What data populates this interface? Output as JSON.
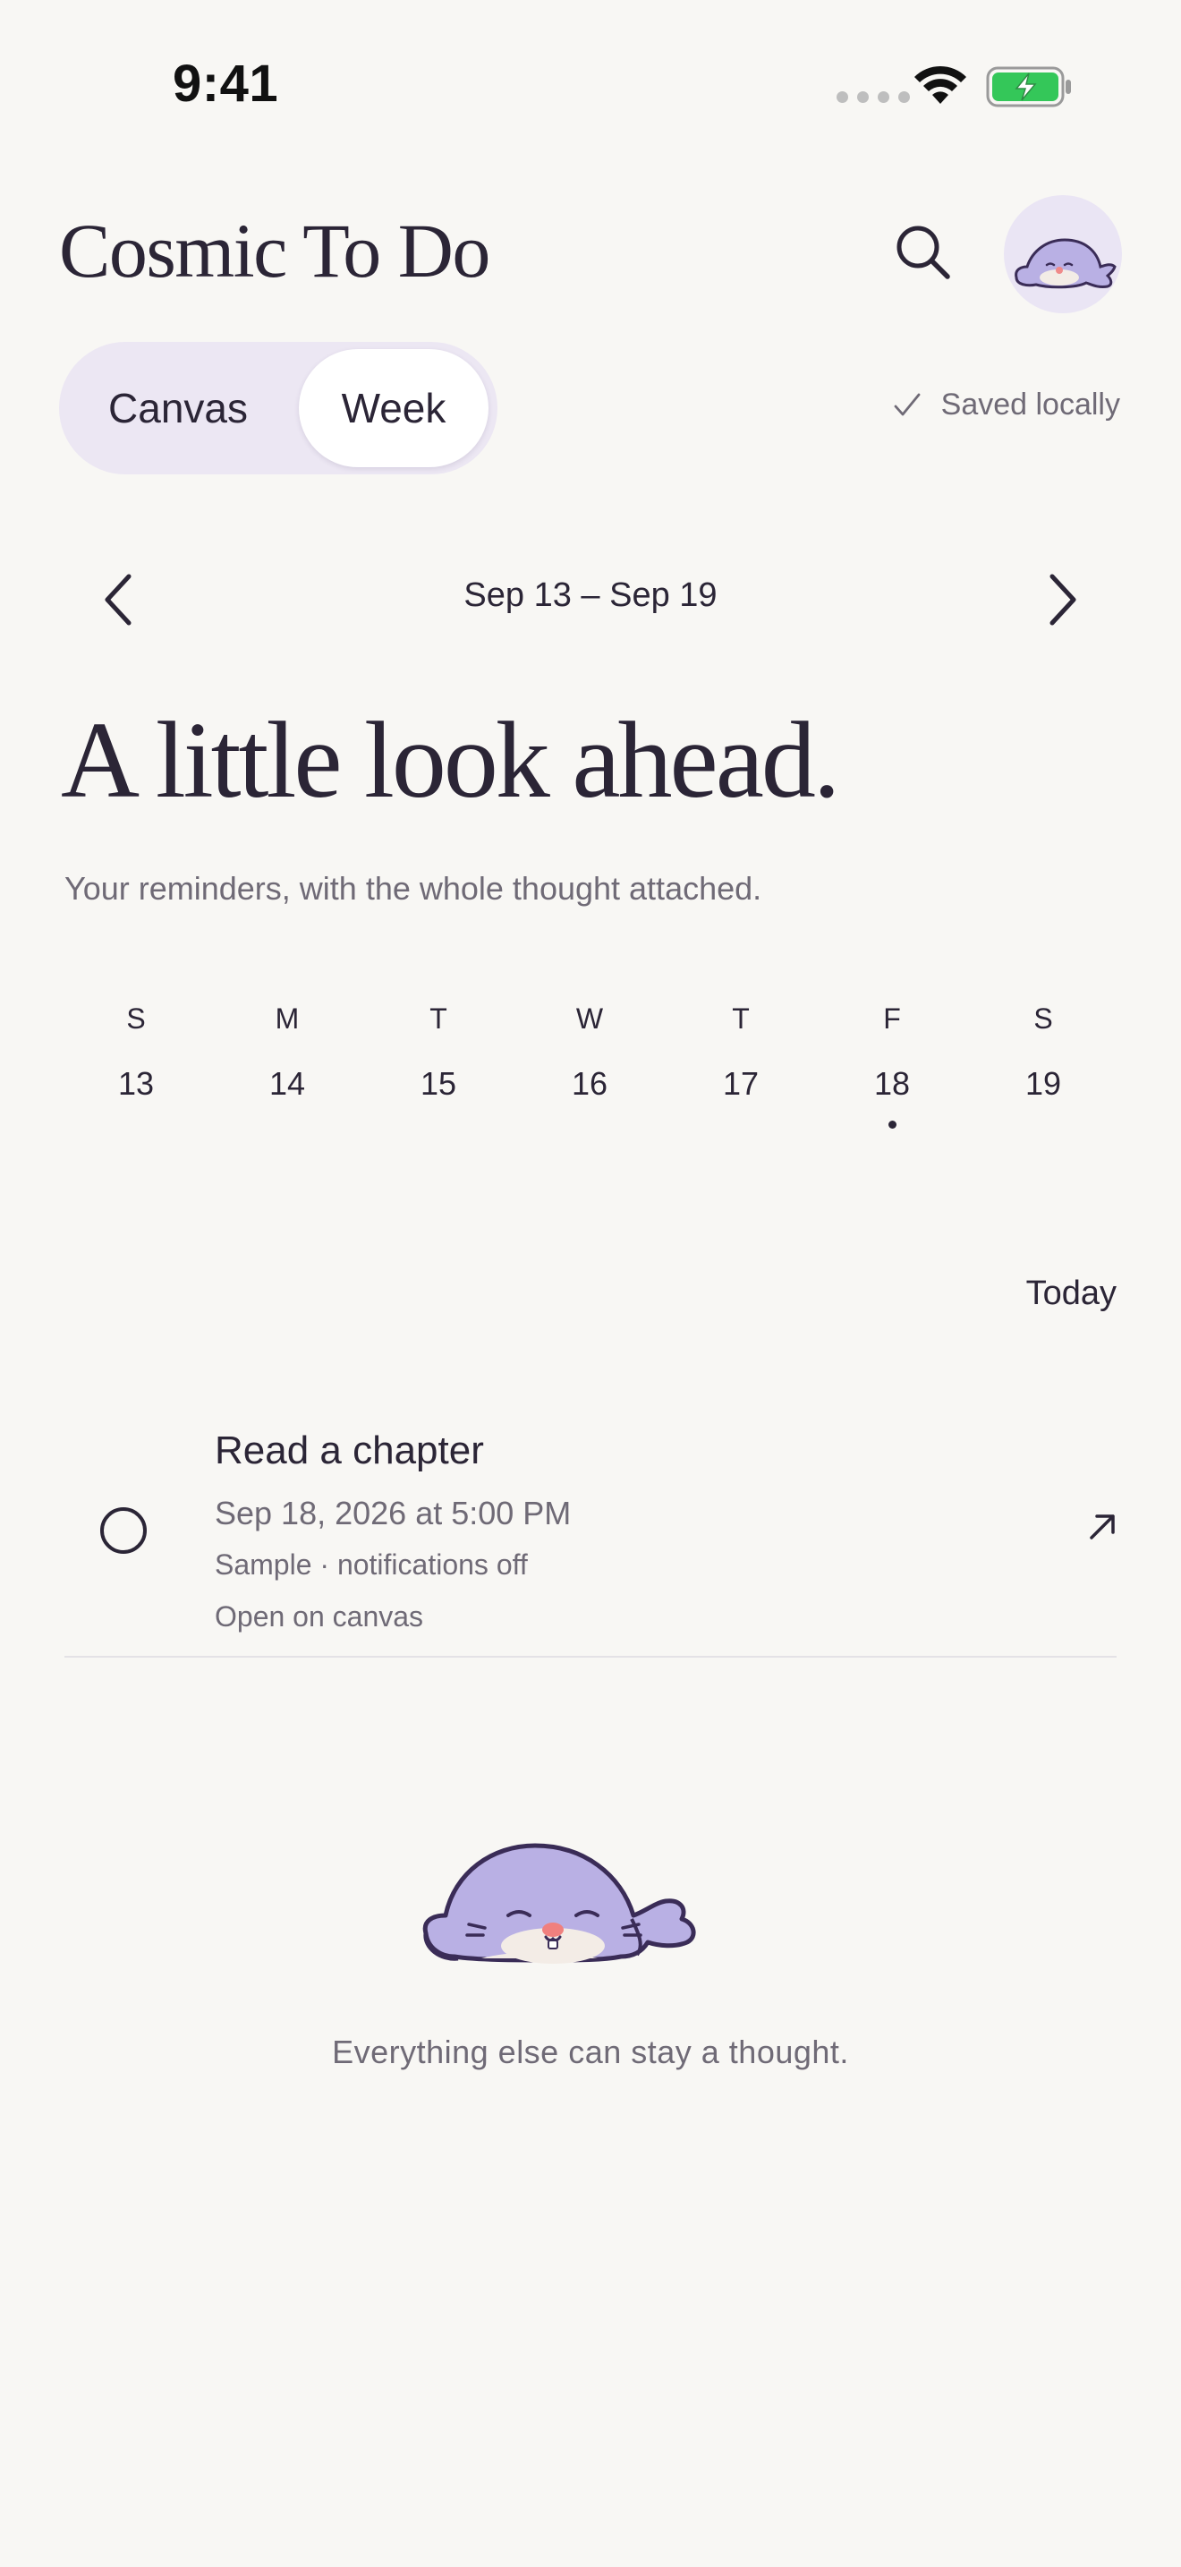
{
  "status_bar": {
    "time": "9:41"
  },
  "header": {
    "app_title": "Cosmic To Do"
  },
  "view_switcher": {
    "options": [
      "Canvas",
      "Week"
    ],
    "selected": "Week"
  },
  "save_status": "Saved locally",
  "week_nav": {
    "range": "Sep 13 – Sep 19"
  },
  "headline": "A little look ahead.",
  "subtitle": "Your reminders, with the whole thought attached.",
  "week": {
    "days": [
      {
        "letter": "S",
        "number": "13",
        "has_item": false
      },
      {
        "letter": "M",
        "number": "14",
        "has_item": false
      },
      {
        "letter": "T",
        "number": "15",
        "has_item": false
      },
      {
        "letter": "W",
        "number": "16",
        "has_item": false
      },
      {
        "letter": "T",
        "number": "17",
        "has_item": false
      },
      {
        "letter": "F",
        "number": "18",
        "has_item": true
      },
      {
        "letter": "S",
        "number": "19",
        "has_item": false
      }
    ]
  },
  "today_button": "Today",
  "reminders": [
    {
      "title": "Read a chapter",
      "datetime": "Sep 18, 2026 at 5:00 PM",
      "meta": "Sample · notifications off",
      "link": "Open on canvas"
    }
  ],
  "empty_state": {
    "text": "Everything else can stay a thought."
  },
  "colors": {
    "background": "#F8F7F4",
    "text": "#2B2536",
    "muted": "#6F6A76",
    "accent_lavender": "#ECE7F3",
    "seal_purple": "#B9B0E4",
    "battery_green": "#34C759"
  }
}
